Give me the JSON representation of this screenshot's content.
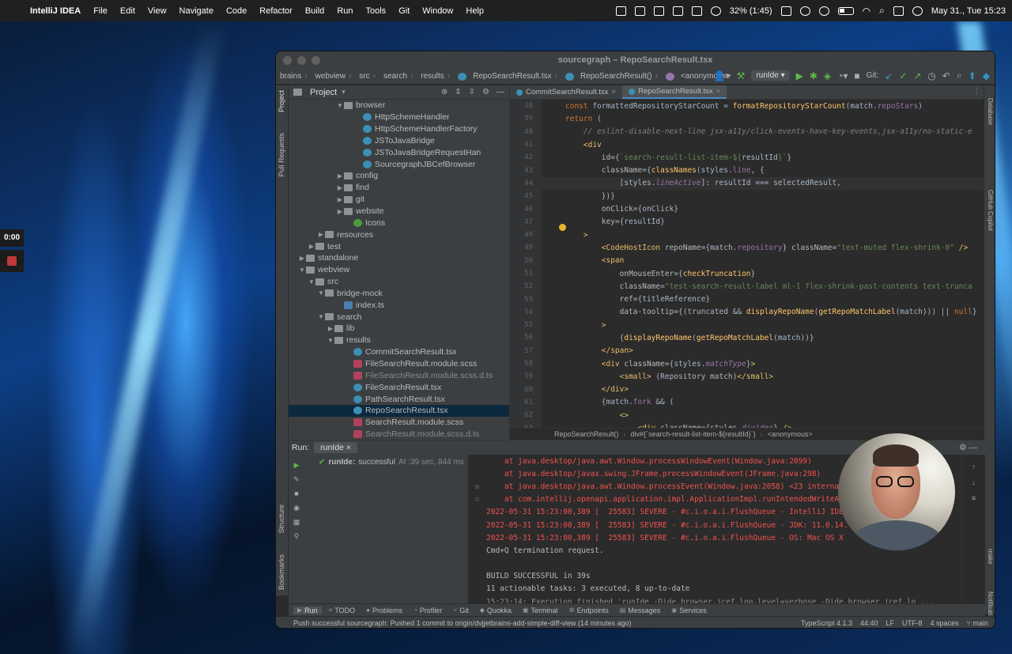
{
  "menubar": {
    "app_name": "IntelliJ IDEA",
    "menus": [
      "File",
      "Edit",
      "View",
      "Navigate",
      "Code",
      "Refactor",
      "Build",
      "Run",
      "Tools",
      "Git",
      "Window",
      "Help"
    ],
    "battery": "32% (1:45)",
    "datetime": "May 31., Tue  15:23"
  },
  "recording": {
    "time": "0:00"
  },
  "window": {
    "title": "sourcegraph – RepoSearchResult.tsx",
    "breadcrumbs": [
      "brains",
      "webview",
      "src",
      "search",
      "results",
      "RepoSearchResult.tsx",
      "RepoSearchResult()",
      "<anonymous>"
    ],
    "run_config": "runIde",
    "git_label": "Git:"
  },
  "left_strip": {
    "project": "Project",
    "pull_requests": "Pull Requests",
    "structure": "Structure",
    "bookmarks": "Bookmarks"
  },
  "right_strip": {
    "database": "Database",
    "copilot": "GitHub Copilot",
    "make": "make",
    "notifications": "Notifications"
  },
  "project": {
    "title": "Project",
    "tree": [
      {
        "label": "browser",
        "type": "folder",
        "indent": 9,
        "open": true
      },
      {
        "label": "HttpSchemeHandler",
        "type": "tsx",
        "indent": 11
      },
      {
        "label": "HttpSchemeHandlerFactory",
        "type": "tsx",
        "indent": 11
      },
      {
        "label": "JSToJavaBridge",
        "type": "tsx",
        "indent": 11
      },
      {
        "label": "JSToJavaBridgeRequestHan",
        "type": "tsx",
        "indent": 11
      },
      {
        "label": "SourcegraphJBCefBrowser",
        "type": "tsx",
        "indent": 11
      },
      {
        "label": "config",
        "type": "folder",
        "indent": 9,
        "open": false
      },
      {
        "label": "find",
        "type": "folder",
        "indent": 9,
        "open": false
      },
      {
        "label": "git",
        "type": "folder",
        "indent": 9,
        "open": false
      },
      {
        "label": "website",
        "type": "folder",
        "indent": 9,
        "open": false
      },
      {
        "label": "Icons",
        "type": "icons",
        "indent": 10
      },
      {
        "label": "resources",
        "type": "folder",
        "indent": 7,
        "open": false
      },
      {
        "label": "test",
        "type": "folder",
        "indent": 6,
        "open": false
      },
      {
        "label": "standalone",
        "type": "folder",
        "indent": 5,
        "open": false
      },
      {
        "label": "webview",
        "type": "folder",
        "indent": 5,
        "open": true
      },
      {
        "label": "src",
        "type": "folder",
        "indent": 6,
        "open": true
      },
      {
        "label": "bridge-mock",
        "type": "folder",
        "indent": 7,
        "open": true
      },
      {
        "label": "index.ts",
        "type": "ts",
        "indent": 9
      },
      {
        "label": "search",
        "type": "folder",
        "indent": 7,
        "open": true
      },
      {
        "label": "lib",
        "type": "folder",
        "indent": 8,
        "open": false
      },
      {
        "label": "results",
        "type": "folder",
        "indent": 8,
        "open": true
      },
      {
        "label": "CommitSearchResult.tsx",
        "type": "tsx",
        "indent": 10
      },
      {
        "label": "FileSearchResult.module.scss",
        "type": "scss",
        "indent": 10
      },
      {
        "label": "FileSearchResult.module.scss.d.ts",
        "type": "scss",
        "indent": 10,
        "dim": true
      },
      {
        "label": "FileSearchResult.tsx",
        "type": "tsx",
        "indent": 10
      },
      {
        "label": "PathSearchResult.tsx",
        "type": "tsx",
        "indent": 10
      },
      {
        "label": "RepoSearchResult.tsx",
        "type": "tsx",
        "indent": 10,
        "selected": true
      },
      {
        "label": "SearchResult.module.scss",
        "type": "scss",
        "indent": 10
      },
      {
        "label": "SearchResult.module.scss.d.ts",
        "type": "scss",
        "indent": 10,
        "dim": true
      }
    ]
  },
  "editor": {
    "tabs": [
      {
        "label": "CommitSearchResult.tsx",
        "active": false
      },
      {
        "label": "RepoSearchResult.tsx",
        "active": true
      }
    ],
    "lines": [
      {
        "n": "38",
        "html": "<span class=\"kw\">const</span> formattedRepositoryStarCount = <span class=\"fn\">formatRepositoryStarCount</span>(match.<span class=\"pr\">repoStars</span>)"
      },
      {
        "n": "39",
        "html": "<span class=\"kw\">return</span> ("
      },
      {
        "n": "40",
        "html": "    <span class=\"cm\">// eslint-disable-next-line jsx-a11y/click-events-have-key-events,jsx-a11y/no-static-e</span>"
      },
      {
        "n": "41",
        "html": "    <span class=\"tg\">&lt;div</span>"
      },
      {
        "n": "42",
        "html": "        <span class=\"at\">id</span>={<span class=\"str\">`search-result-list-item-${</span>resultId<span class=\"str\">}`</span>}"
      },
      {
        "n": "43",
        "html": "        <span class=\"at\">className</span>={<span class=\"fn\">classNames</span>(styles.<span class=\"pr\">line</span>, {"
      },
      {
        "n": "44",
        "html": "            [styles.<span class=\"prb\">lineActive</span>]: resultId === selectedResult,",
        "hl": true
      },
      {
        "n": "45",
        "html": "        })}"
      },
      {
        "n": "46",
        "html": "        <span class=\"at\">onClick</span>={onClick}"
      },
      {
        "n": "47",
        "html": "        <span class=\"at\">key</span>={resultId}"
      },
      {
        "n": "48",
        "html": "    <span class=\"tg\">&gt;</span>"
      },
      {
        "n": "49",
        "html": "        <span class=\"tg\">&lt;CodeHostIcon</span> <span class=\"at\">repoName</span>={match.<span class=\"pr\">repository</span>} <span class=\"at\">className</span>=<span class=\"str\">\"text-muted flex-shrink-0\"</span> <span class=\"tg\">/&gt;</span>"
      },
      {
        "n": "50",
        "html": "        <span class=\"tg\">&lt;span</span>"
      },
      {
        "n": "51",
        "html": "            <span class=\"at\">onMouseEnter</span>={<span class=\"fn\">checkTruncation</span>}"
      },
      {
        "n": "52",
        "html": "            <span class=\"at\">className</span>=<span class=\"str\">\"test-search-result-label ml-1 flex-shrink-past-contents text-trunca</span>"
      },
      {
        "n": "53",
        "html": "            <span class=\"at\">ref</span>={titleReference}"
      },
      {
        "n": "54",
        "html": "            <span class=\"at\">data-tooltip</span>={(truncated &amp;&amp; <span class=\"fn\">displayRepoName</span>(<span class=\"fn\">getRepoMatchLabel</span>(match))) || <span class=\"kw\">null</span>}"
      },
      {
        "n": "55",
        "html": "        <span class=\"tg\">&gt;</span>"
      },
      {
        "n": "56",
        "html": "            {<span class=\"fn\">displayRepoName</span>(<span class=\"fn\">getRepoMatchLabel</span>(match))}"
      },
      {
        "n": "57",
        "html": "        <span class=\"tg\">&lt;/span&gt;</span>"
      },
      {
        "n": "58",
        "html": "        <span class=\"tg\">&lt;div</span> <span class=\"at\">className</span>={styles.<span class=\"prb\">matchType</span>}<span class=\"tg\">&gt;</span>"
      },
      {
        "n": "59",
        "html": "            <span class=\"tg\">&lt;small&gt;</span> (Repository match)<span class=\"tg\">&lt;/small&gt;</span>"
      },
      {
        "n": "60",
        "html": "        <span class=\"tg\">&lt;/div&gt;</span>"
      },
      {
        "n": "61",
        "html": "        {match.<span class=\"pr\">fork</span> &amp;&amp; ("
      },
      {
        "n": "62",
        "html": "            <span class=\"tg\">&lt;&gt;</span>"
      },
      {
        "n": "63",
        "html": "                <span class=\"tg\">&lt;div</span> <span class=\"at\">className</span>={styles.<span class=\"prb\">divider</span>} <span class=\"tg\">/&gt;</span>"
      }
    ],
    "bottom_crumbs": [
      "RepoSearchResult()",
      "div#{`search-result-list-item-${resultId}`}",
      "<anonymous>"
    ]
  },
  "run_panel": {
    "label": "Run:",
    "tab": "runIde",
    "status_name": "runIde:",
    "status_text": "successful",
    "status_time": "At :39 sec, 844 ms",
    "console": [
      {
        "fold": "",
        "cls": "red",
        "text": "    at java.desktop/java.awt.Window.processWindowEvent(Window.java:2099)"
      },
      {
        "fold": "",
        "cls": "red",
        "text": "    at java.desktop/javax.swing.JFrame.processWindowEvent(JFrame.java:298)"
      },
      {
        "fold": "⊞",
        "cls": "red",
        "text": "    at java.desktop/java.awt.Window.processEvent(Window.java:2058) <23 internal"
      },
      {
        "fold": "⊟",
        "cls": "red",
        "text": "    at com.intellij.openapi.application.impl.ApplicationImpl.runIntendedWriteAc"
      },
      {
        "fold": "",
        "cls": "red",
        "text": "2022-05-31 15:23:00,389 [  25583] SEVERE - #c.i.o.a.i.FlushQueue - IntelliJ IDE"
      },
      {
        "fold": "",
        "cls": "red",
        "text": "2022-05-31 15:23:00,389 [  25583] SEVERE - #c.i.o.a.i.FlushQueue - JDK: 11.0.14."
      },
      {
        "fold": "",
        "cls": "red",
        "text": "2022-05-31 15:23:00,389 [  25583] SEVERE - #c.i.o.a.i.FlushQueue - OS: Mac OS X"
      },
      {
        "fold": "",
        "cls": "",
        "text": "Cmd+Q termination request."
      },
      {
        "fold": "",
        "cls": "",
        "text": ""
      },
      {
        "fold": "",
        "cls": "",
        "text": "BUILD SUCCESSFUL in 39s"
      },
      {
        "fold": "",
        "cls": "",
        "text": "11 actionable tasks: 3 executed, 8 up-to-date"
      },
      {
        "fold": "",
        "cls": "gray",
        "text": "15:23:14: Execution finished 'runIde -Dide.browser.jcef.log.level=verbose -Dide.browser.jcef.lo ..."
      }
    ]
  },
  "tool_tabs": [
    {
      "label": "Run",
      "icon": "▶",
      "active": true
    },
    {
      "label": "TODO",
      "icon": "≡",
      "active": false
    },
    {
      "label": "Problems",
      "icon": "●",
      "active": false
    },
    {
      "label": "Profiler",
      "icon": "◔",
      "active": false
    },
    {
      "label": "Git",
      "icon": "⑂",
      "active": false
    },
    {
      "label": "Quokka",
      "icon": "◆",
      "active": false
    },
    {
      "label": "Terminal",
      "icon": "▣",
      "active": false
    },
    {
      "label": "Endpoints",
      "icon": "⚙",
      "active": false
    },
    {
      "label": "Messages",
      "icon": "▤",
      "active": false
    },
    {
      "label": "Services",
      "icon": "◉",
      "active": false
    }
  ],
  "status_bar": {
    "message": "Push successful sourcegraph: Pushed 1 commit to origin/dvjjetbrains-add-simple-diff-view (14 minutes ago)",
    "typescript": "TypeScript 4.1.3",
    "position": "44:40",
    "line_sep": "LF",
    "encoding": "UTF-8",
    "indent": "4 spaces",
    "branch": "main"
  }
}
